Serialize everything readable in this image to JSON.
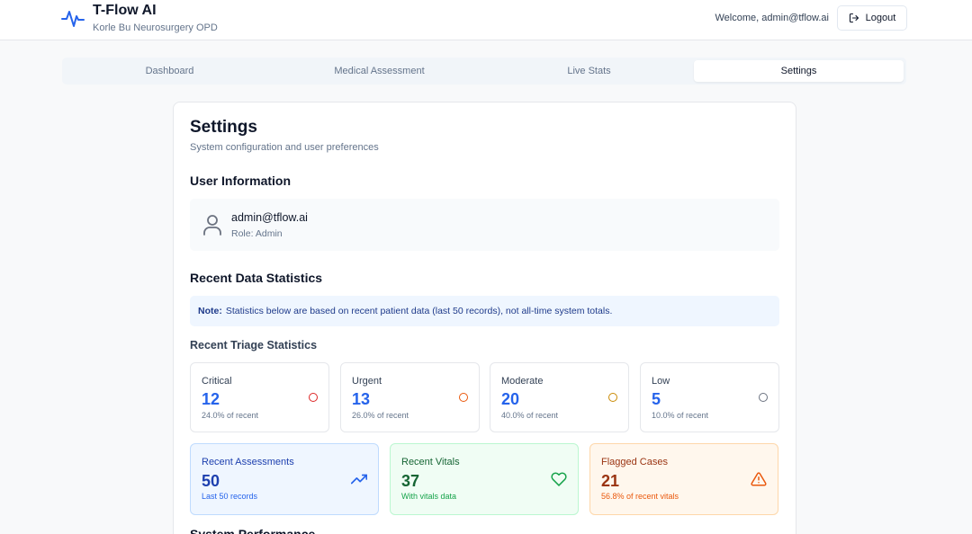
{
  "app": {
    "title": "T-Flow AI",
    "subtitle": "Korle Bu Neurosurgery OPD"
  },
  "header": {
    "welcome_text": "Welcome, admin@tflow.ai",
    "logout_label": "Logout"
  },
  "tabs": [
    {
      "label": "Dashboard",
      "active": false
    },
    {
      "label": "Medical Assessment",
      "active": false
    },
    {
      "label": "Live Stats",
      "active": false
    },
    {
      "label": "Settings",
      "active": true
    }
  ],
  "settings": {
    "title": "Settings",
    "subtitle": "System configuration and user preferences",
    "user_section_title": "User Information",
    "user": {
      "email": "admin@tflow.ai",
      "role": "Role: Admin"
    },
    "stats_section_title": "Recent Data Statistics",
    "note": {
      "label": "Note:",
      "text": "Statistics below are based on recent patient data (last 50 records), not all-time system totals."
    },
    "triage_title": "Recent Triage Statistics",
    "triage": [
      {
        "label": "Critical",
        "value": "12",
        "sub": "24.0% of recent",
        "color": "#dc2626"
      },
      {
        "label": "Urgent",
        "value": "13",
        "sub": "26.0% of recent",
        "color": "#ea580c"
      },
      {
        "label": "Moderate",
        "value": "20",
        "sub": "40.0% of recent",
        "color": "#ca8a04"
      },
      {
        "label": "Low",
        "value": "5",
        "sub": "10.0% of recent",
        "color": "#6b7280"
      }
    ],
    "summary": [
      {
        "label": "Recent Assessments",
        "value": "50",
        "sub": "Last 50 records",
        "icon": "trending-up-icon",
        "bg": "#eff6ff",
        "border": "#bfdbfe",
        "color": "#1e40af",
        "accent": "#2563eb"
      },
      {
        "label": "Recent Vitals",
        "value": "37",
        "sub": "With vitals data",
        "icon": "heart-icon",
        "bg": "#f0fdf4",
        "border": "#bbf7d0",
        "color": "#166534",
        "accent": "#16a34a"
      },
      {
        "label": "Flagged Cases",
        "value": "21",
        "sub": "56.8% of recent vitals",
        "icon": "alert-triangle-icon",
        "bg": "#fff7ed",
        "border": "#fed7aa",
        "color": "#9a3412",
        "accent": "#ea580c"
      }
    ],
    "performance_title": "System Performance"
  }
}
